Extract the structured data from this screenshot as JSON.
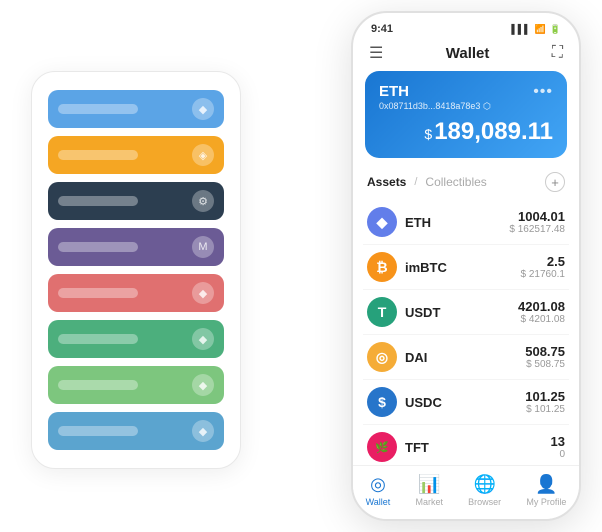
{
  "statusBar": {
    "time": "9:41",
    "signal": "▌▌▌",
    "wifi": "WiFi",
    "battery": "🔋"
  },
  "header": {
    "menuIcon": "☰",
    "title": "Wallet",
    "expandIcon": "⛶"
  },
  "walletCard": {
    "tokenName": "ETH",
    "address": "0x08711d3b...8418a78e3",
    "addressSuffix": "⬡",
    "moreIcon": "•••",
    "dollarSymbol": "$",
    "balance": "189,089.11"
  },
  "assets": {
    "activeTab": "Assets",
    "separator": "/",
    "inactiveTab": "Collectibles",
    "addIcon": "+"
  },
  "assetList": [
    {
      "symbol": "ETH",
      "iconSymbol": "◆",
      "iconClass": "eth-icon",
      "amount": "1004.01",
      "usdValue": "$ 162517.48"
    },
    {
      "symbol": "imBTC",
      "iconSymbol": "₿",
      "iconClass": "imbtc-icon",
      "amount": "2.5",
      "usdValue": "$ 21760.1"
    },
    {
      "symbol": "USDT",
      "iconSymbol": "T",
      "iconClass": "usdt-icon",
      "amount": "4201.08",
      "usdValue": "$ 4201.08"
    },
    {
      "symbol": "DAI",
      "iconSymbol": "◎",
      "iconClass": "dai-icon",
      "amount": "508.75",
      "usdValue": "$ 508.75"
    },
    {
      "symbol": "USDC",
      "iconSymbol": "$",
      "iconClass": "usdc-icon",
      "amount": "101.25",
      "usdValue": "$ 101.25"
    },
    {
      "symbol": "TFT",
      "iconSymbol": "🌿",
      "iconClass": "tft-icon",
      "amount": "13",
      "usdValue": "0"
    }
  ],
  "tabBar": {
    "tabs": [
      {
        "label": "Wallet",
        "icon": "◎",
        "active": true
      },
      {
        "label": "Market",
        "icon": "📊",
        "active": false
      },
      {
        "label": "Browser",
        "icon": "🌐",
        "active": false
      },
      {
        "label": "My Profile",
        "icon": "👤",
        "active": false
      }
    ]
  },
  "cardStack": {
    "cards": [
      {
        "color": "cr-blue",
        "icon": "◆"
      },
      {
        "color": "cr-orange",
        "icon": "◈"
      },
      {
        "color": "cr-dark",
        "icon": "⚙"
      },
      {
        "color": "cr-purple",
        "icon": "M"
      },
      {
        "color": "cr-red",
        "icon": "◆"
      },
      {
        "color": "cr-green",
        "icon": "◆"
      },
      {
        "color": "cr-lightgreen",
        "icon": "◆"
      },
      {
        "color": "cr-lightblue",
        "icon": "◆"
      }
    ]
  }
}
